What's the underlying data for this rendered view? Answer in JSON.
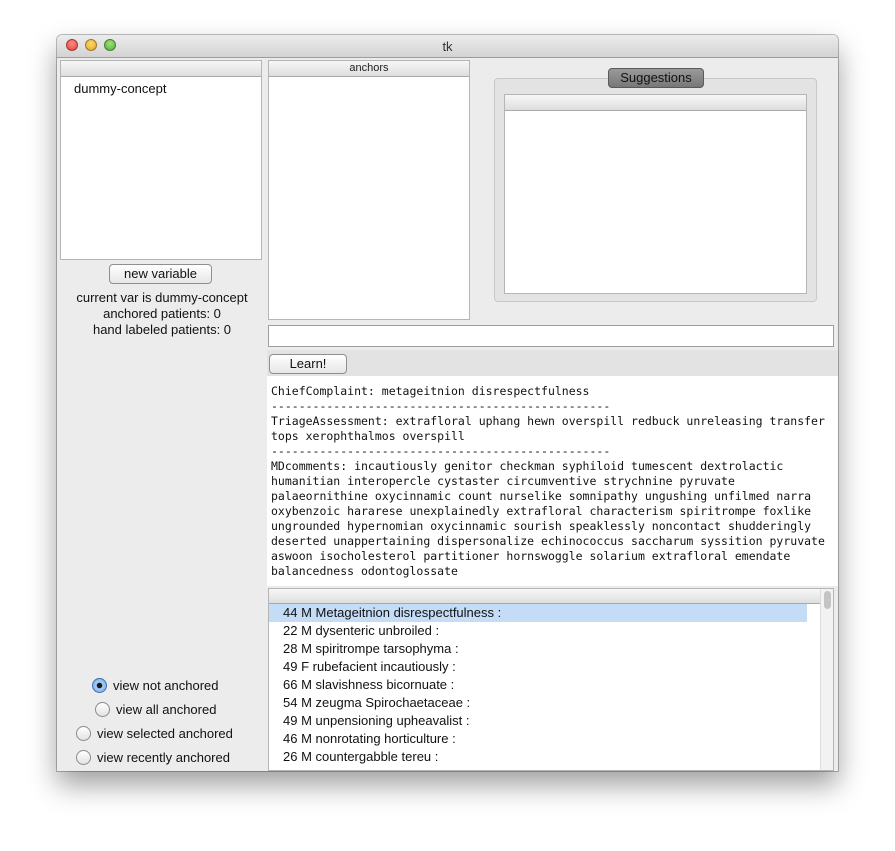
{
  "window": {
    "title": "tk"
  },
  "variables": {
    "items": [
      "dummy-concept"
    ]
  },
  "new_variable_button": "new variable",
  "status": {
    "current_var": "current var is dummy-concept",
    "anchored": "anchored patients: 0",
    "hand_labeled": "hand labeled patients: 0"
  },
  "anchors": {
    "header": "anchors"
  },
  "suggestions": {
    "tab_label": "Suggestions"
  },
  "search": {
    "value": ""
  },
  "learn_button": "Learn!",
  "note": {
    "chief_complaint": "ChiefComplaint: metageitnion disrespectfulness",
    "separator": "-------------------------------------------------",
    "triage": "TriageAssessment: extrafloral uphang hewn overspill redbuck unreleasing transfer tops xerophthalmos overspill",
    "md_comments": "MDcomments: incautiously genitor checkman syphiloid tumescent dextrolactic humanitian interopercle cystaster circumventive strychnine pyruvate palaeornithine oxycinnamic count nurselike somnipathy ungushing unfilmed narra oxybenzoic hararese unexplainedly extrafloral characterism spiritrompe foxlike ungrounded hypernomian oxycinnamic sourish speaklessly noncontact shudderingly deserted unappertaining dispersonalize echinococcus saccharum syssition pyruvate aswoon isocholesterol partitioner hornswoggle solarium extrafloral emendate balancedness odontoglossate"
  },
  "patients": [
    "44 M Metageitnion disrespectfulness :",
    "22 M dysenteric unbroiled :",
    "28 M spiritrompe tarsophyma :",
    "49 F rubefacient incautiously :",
    "66 M slavishness bicornuate :",
    "54 M zeugma Spirochaetaceae :",
    "49 M unpensioning upheavalist :",
    "46 M nonrotating horticulture :",
    "26 M countergabble tereu :"
  ],
  "view_options": {
    "not_anchored": "view not anchored",
    "all_anchored": "view all anchored",
    "selected_anchored": "view selected anchored",
    "recently_anchored": "view recently anchored",
    "selected": "not_anchored"
  }
}
